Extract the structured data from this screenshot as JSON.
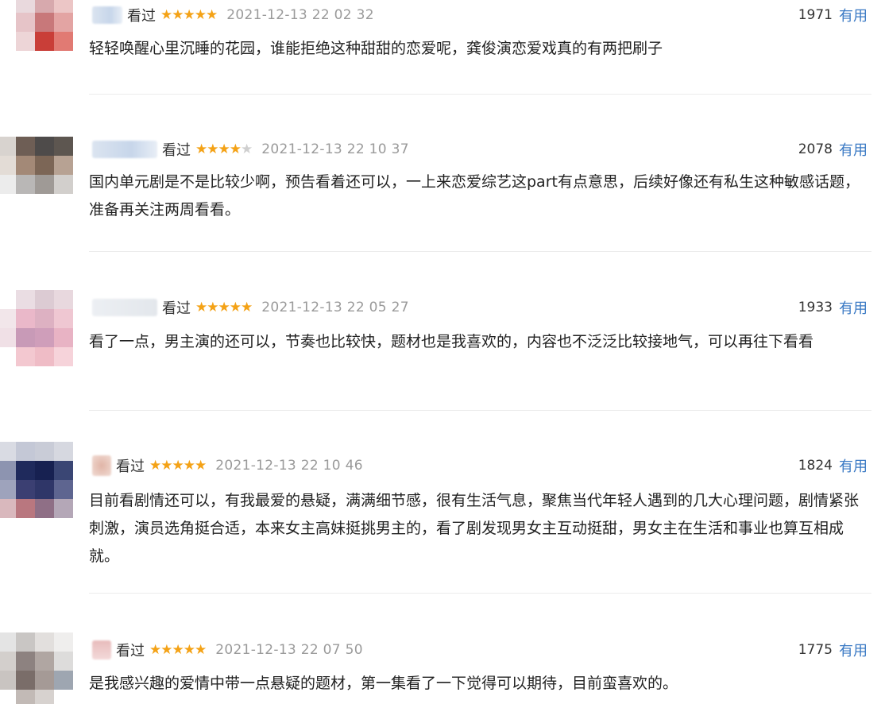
{
  "reviews": [
    {
      "status": "看过",
      "rating": 5,
      "date": "2021-12-13 22 02 32",
      "votes": "1971",
      "useful": "有用",
      "text": "轻轻唤醒心里沉睡的花园，谁能拒绝这种甜甜的恋爱呢，龚俊演恋爱戏真的有两把刷子"
    },
    {
      "status": "看过",
      "rating": 4,
      "date": "2021-12-13 22 10 37",
      "votes": "2078",
      "useful": "有用",
      "text": "国内单元剧是不是比较少啊，预告看着还可以，一上来恋爱综艺这part有点意思，后续好像还有私生这种敏感话题，准备再关注两周看看。"
    },
    {
      "status": "看过",
      "rating": 5,
      "date": "2021-12-13 22 05 27",
      "votes": "1933",
      "useful": "有用",
      "text": "看了一点，男主演的还可以，节奏也比较快，题材也是我喜欢的，内容也不泛泛比较接地气，可以再往下看看"
    },
    {
      "status": "看过",
      "rating": 5,
      "date": "2021-12-13 22 10 46",
      "votes": "1824",
      "useful": "有用",
      "text": "目前看剧情还可以，有我最爱的悬疑，满满细节感，很有生活气息，聚焦当代年轻人遇到的几大心理问题，剧情紧张刺激，演员选角挺合适，本来女主高妹挺挑男主的，看了剧发现男女主互动挺甜，男女主在生活和事业也算互相成就。"
    },
    {
      "status": "看过",
      "rating": 5,
      "date": "2021-12-13 22 07 50",
      "votes": "1775",
      "useful": "有用",
      "text": "是我感兴趣的爱情中带一点悬疑的题材，第一集看了一下觉得可以期待，目前蛮喜欢的。"
    }
  ],
  "colors": {
    "star": "#f4a216",
    "star_empty": "#cfcfcf",
    "link": "#3a79c4",
    "date": "#9a9a9a"
  }
}
